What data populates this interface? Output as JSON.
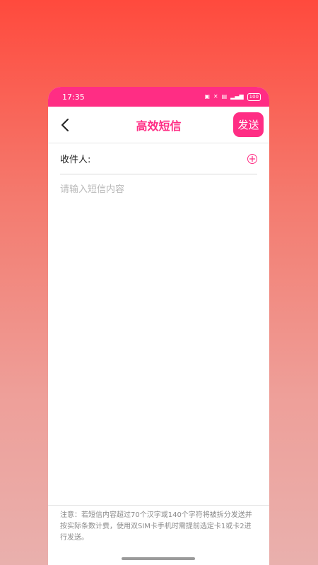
{
  "status_bar": {
    "time": "17:35",
    "battery": "100"
  },
  "header": {
    "title": "高效短信",
    "send_label": "发送"
  },
  "recipient": {
    "label": "收件人:"
  },
  "message": {
    "placeholder": "请输入短信内容",
    "value": ""
  },
  "notice": {
    "text": "注意：若短信内容超过70个汉字或140个字符将被拆分发送并按实际条数计费，使用双SIM卡手机时需提前选定卡1或卡2进行发送。"
  },
  "colors": {
    "accent": "#ff2d84",
    "background_top": "#ff4a3d",
    "background_bottom": "#e9b0ad"
  },
  "icons": [
    "back-icon",
    "add-recipient-icon",
    "signal-icon",
    "wifi-icon",
    "battery-icon"
  ]
}
